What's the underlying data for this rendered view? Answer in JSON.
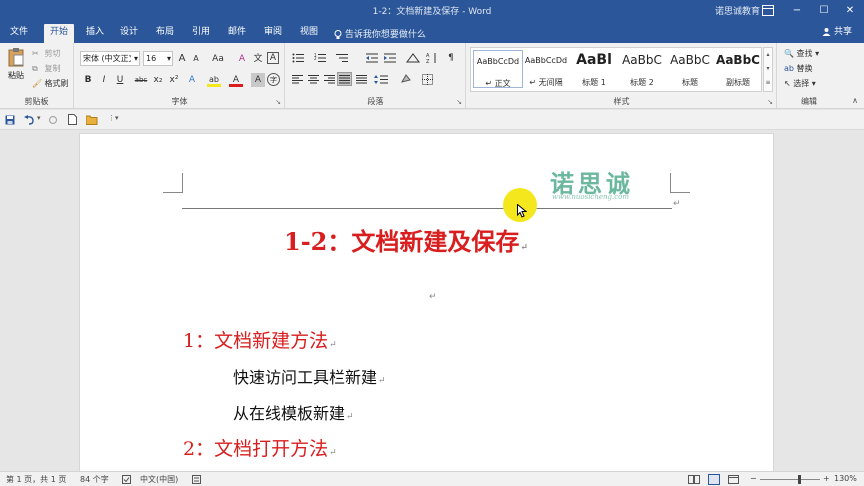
{
  "titlebar": {
    "title": "1-2：文档新建及保存 - Word",
    "org": "诺思诚教育",
    "restore_icon": "ribbon-display-icon",
    "minimize": "−",
    "maximize": "☐",
    "close": "✕"
  },
  "tabs": [
    "文件",
    "开始",
    "插入",
    "设计",
    "布局",
    "引用",
    "邮件",
    "审阅",
    "视图"
  ],
  "active_tab": "开始",
  "tellme": "告诉我你想要做什么",
  "share": "共享",
  "ribbon": {
    "clipboard": {
      "label": "剪贴板",
      "paste": "粘贴",
      "cut": "剪切",
      "copy": "复制",
      "format_painter": "格式刷"
    },
    "font": {
      "label": "字体",
      "font_name": "宋体 (中文正文)",
      "font_size": "16",
      "grow": "A",
      "shrink": "A",
      "case": "Aa",
      "clear": "A",
      "wen": "文",
      "char_border": "A",
      "bold": "B",
      "italic": "I",
      "underline": "U",
      "strike": "abc",
      "sub": "x₂",
      "sup": "x²",
      "effects": "A",
      "highlight": "ab",
      "color": "A",
      "shade": "A",
      "encircle": "字"
    },
    "paragraph": {
      "label": "段落"
    },
    "styles": {
      "label": "样式",
      "items": [
        {
          "preview": "AaBbCcDd",
          "name": "↵ 正文"
        },
        {
          "preview": "AaBbCcDd",
          "name": "↵ 无间隔"
        },
        {
          "preview": "AaBl",
          "name": "标题 1"
        },
        {
          "preview": "AaBbC",
          "name": "标题 2"
        },
        {
          "preview": "AaBbC",
          "name": "标题"
        },
        {
          "preview": "AaBbC",
          "name": "副标题"
        }
      ]
    },
    "editing": {
      "label": "编辑",
      "find": "查找",
      "replace": "替换",
      "select": "选择"
    }
  },
  "document": {
    "logo_text": "诺思诚",
    "logo_url": "www.nuosicheng.com",
    "title": "1-2：文档新建及保存",
    "heading1": "1：文档新建方法",
    "item1": "快速访问工具栏新建",
    "item2": "从在线模板新建",
    "heading2": "2：文档打开方法",
    "para_mark": "↵"
  },
  "status": {
    "page": "第 1 页，共 1 页",
    "words": "84 个字",
    "lang": "中文(中国)",
    "zoom": "130%",
    "zoom_minus": "−",
    "zoom_plus": "+"
  },
  "colors": {
    "brand": "#2b579a",
    "title_red": "#d81e1e",
    "logo_green": "#6bb89f",
    "highlight": "#f4e71d"
  }
}
